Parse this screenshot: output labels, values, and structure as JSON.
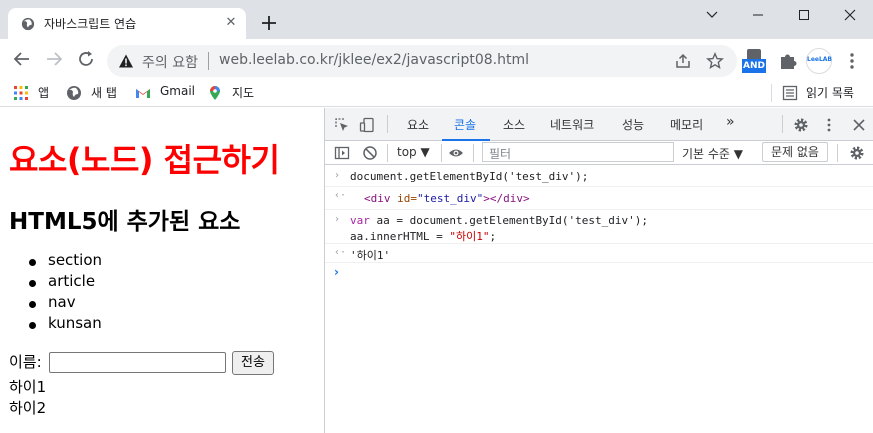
{
  "tab": {
    "title": "자바스크립트 연습",
    "close": "✕",
    "new_tab": "+"
  },
  "toolbar": {
    "security_label": "주의 요함",
    "url": "web.leelab.co.kr/jklee/ex2/javascript08.html"
  },
  "extensions": {
    "and_badge": "AND",
    "leelab_label": "LeeLAB"
  },
  "bookmarks": {
    "items": [
      "앱",
      "새 탭",
      "Gmail",
      "지도"
    ],
    "reading_list": "읽기 목록"
  },
  "page": {
    "title": "요소(노드) 접근하기",
    "subtitle": "HTML5에 추가된 요소",
    "list": [
      "section",
      "article",
      "nav",
      "kunsan"
    ],
    "form_label": "이름:",
    "submit_label": "전송",
    "outputs": [
      "하이1",
      "하이2"
    ]
  },
  "devtools": {
    "tabs": [
      "요소",
      "콘솔",
      "소스",
      "네트워크",
      "성능",
      "메모리",
      "»"
    ],
    "active_tab": "콘솔",
    "context": "top ▼",
    "filter_placeholder": "필터",
    "levels": "기본 수준 ▼",
    "issues": "문제 없음",
    "console": {
      "l1": "document.getElementById('test_div');",
      "l2_tag_open": "<div",
      "l2_attr": " id=",
      "l2_val": "\"test_div\"",
      "l2_close": "></div>",
      "l3_kw": "var",
      "l3_rest": " aa = document.getElementById('test_div');",
      "l4_a": "aa.innerHTML = ",
      "l4_str": "\"하이1\"",
      "l4_end": ";",
      "l5": "'하이1'"
    }
  }
}
